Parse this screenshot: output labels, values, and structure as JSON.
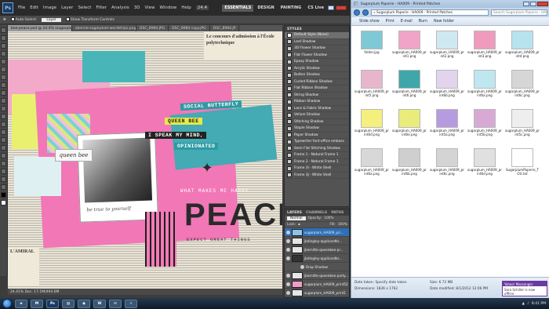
{
  "photoshop": {
    "logo": "Ps",
    "menus": [
      "File",
      "Edit",
      "Image",
      "Layer",
      "Select",
      "Filter",
      "Analysis",
      "3D",
      "View",
      "Window",
      "Help"
    ],
    "zoom": "24.4",
    "workspaces": [
      "ESSENTIALS",
      "DESIGN",
      "PAINTING"
    ],
    "workspace_active": "ESSENTIALS",
    "cslive": "CS Live",
    "options": {
      "auto_select": "Auto-Select:",
      "auto_select_value": "Layer",
      "transform": "Show Transform Controls"
    },
    "doc_tabs": [
      "bee-peace.psd @ 24.4% (sugarplum_HA009_print59, RGB/8) *",
      "sbernie-sugarplum-wordstrips.png",
      "DSC_8984.JPG",
      "DSC_8984 copy.JPG",
      "DSC_8984.JP"
    ],
    "status": "24.41%   Doc: 17.1M/494.6M",
    "canvas": {
      "word_strips": [
        "SOCIAL BUTTERFLY",
        "QUEEN BEE",
        "I SPEAK MY MIND,",
        "OPINIONATED"
      ],
      "queen_bee_tag": "queen bee",
      "true_to_yourself": "be true to yourself",
      "what_makes": "WHAT MAKES ME HAPPY",
      "peace": "PEACE",
      "expect": "EXPECT GREAT THINGS",
      "newspaper_top": "Le concours d'admission à l'École polytechnique",
      "newspaper_corner": "L'AMIRAL"
    },
    "styles_panel": {
      "title": "STYLES",
      "items": [
        "Default Style (None)",
        "Leaf Shadow",
        "3D Flower Shadow",
        "Flat Flower Shadow",
        "Epoxy Shadow",
        "Acrylic Shadow",
        "Button Shadow",
        "Curled Ribbon Shadow",
        "Flat Ribbon Shadow",
        "String Shadow",
        "Ribbon Shadow",
        "Lace & Fabric Shadow",
        "Vellum Shadow",
        "Stitching Shadow",
        "Staple Shadow",
        "Paper Shadow",
        "Typewriter font-office emboss",
        "Semi Flat Stitching Shadow",
        "Frame 1 - Natural Frame 1",
        "Frame 2 - Natural Frame 1",
        "Frame 3I - White Shell",
        "Frame 3J - White Shell"
      ]
    },
    "layers_panel": {
      "tabs": [
        "LAYERS",
        "CHANNELS",
        "PATHS"
      ],
      "blend_mode": "Normal",
      "opacity_label": "Opacity:",
      "opacity": "100%",
      "fill_label": "Fill:",
      "fill": "100%",
      "lock_label": "Lock:",
      "layers": [
        "sugarplum_HA009_pri...",
        "jbdingley-applicardbr...",
        "jbernitte-queenbee-pr...",
        "jbdingley-applicardbr...",
        "Drop Shadow",
        "jbernitte-queenbee-party...",
        "sugarplum_HA009_print52",
        "sugarplum_HA009_print1",
        "sugarplum_HA009_print66"
      ]
    }
  },
  "explorer": {
    "title": "Sugarplum Paperie - HA009 - Printed Patches",
    "breadcrumb": "« Sugarplum Paperie - HA009 - Printed Patches",
    "search_placeholder": "Search Sugarplum Paperie - HA009 - ...",
    "commands": [
      "Slide show",
      "Print",
      "E-mail",
      "Burn",
      "New folder"
    ],
    "files": [
      {
        "name": "folder.jpg",
        "color": "#7fc9d6"
      },
      {
        "name": "sugarplum_HA009_print1.png",
        "color": "#f2a4c8"
      },
      {
        "name": "sugarplum_HA009_print2.png",
        "color": "#cfe9f2"
      },
      {
        "name": "sugarplum_HA009_print3.png",
        "color": "#ef9bbd"
      },
      {
        "name": "sugarplum_HA009_print4.png",
        "color": "#b7e3ee"
      },
      {
        "name": "sugarplum_HA009_print5.png",
        "color": "#e8b6cc"
      },
      {
        "name": "sugarplum_HA009_print6.png",
        "color": "#3fa7a9"
      },
      {
        "name": "sugarplum_HA009_print6b.png",
        "color": "#e2d4ec"
      },
      {
        "name": "sugarplum_HA009_print6a.png",
        "color": "#bfe7ef"
      },
      {
        "name": "sugarplum_HA009_print6c.png",
        "color": "#d6d6d6"
      },
      {
        "name": "sugarplum_HA009_print6d.png",
        "color": "#f5ef7e"
      },
      {
        "name": "sugarplum_HA009_print6e.png",
        "color": "#e9ec7a"
      },
      {
        "name": "sugarplum_HA009_print5a.png",
        "color": "#b79be0"
      },
      {
        "name": "sugarplum_HA009_print5b.png",
        "color": "#d9a9d6"
      },
      {
        "name": "sugarplum_HA009_print5c.png",
        "color": "#eeeeee"
      },
      {
        "name": "sugarplum_HA009_print6a.png",
        "color": "#d8d8d8"
      },
      {
        "name": "sugarplum_HA009_print6b.png",
        "color": "#cfcfcf"
      },
      {
        "name": "sugarplum_HA009_print6c.png",
        "color": "#d4d4d4"
      },
      {
        "name": "sugarplum_HA009_print6d.png",
        "color": "#e0e0e0"
      },
      {
        "name": "SugarplumPaperie_TOU.txt",
        "color": "#ffffff"
      }
    ],
    "details": {
      "item_label": "Date taken:",
      "item_value": "Specify date taken",
      "dimensions_label": "Dimensions:",
      "dimensions_value": "1836 x 1762",
      "size_label": "Size:",
      "size_value": "6.72 MB",
      "modified_label": "Date modified:",
      "modified_value": "8/1/2012 12:06 PM"
    }
  },
  "taskbar": {
    "apps": [
      "e",
      "M",
      "Ps",
      "▤",
      "◉",
      "W",
      "✉",
      "☼"
    ],
    "clock": "8:41 PM"
  },
  "notification": {
    "title": "Yahoo! Messenger",
    "body": "Sara Schiller is now offline"
  },
  "colors": {
    "pink": "#f06fb0",
    "teal": "#35a9b4",
    "yellow": "#e5ea4a",
    "selected_layer": "#2f6fb5"
  }
}
